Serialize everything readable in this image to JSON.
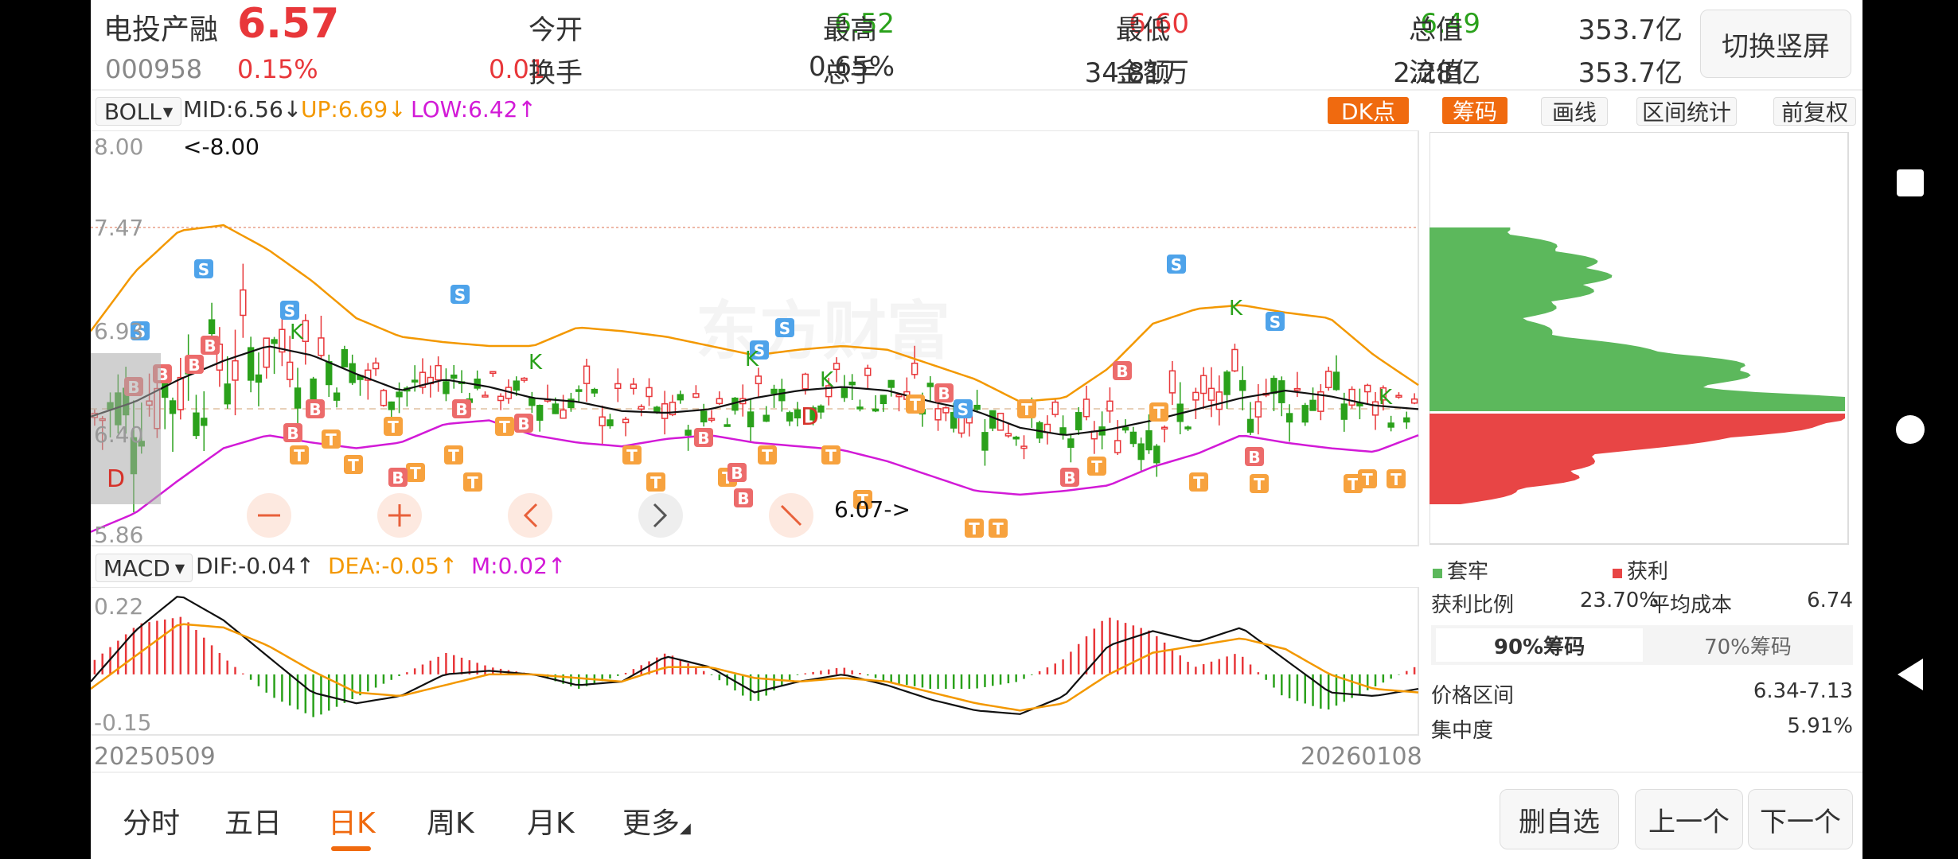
{
  "stock": {
    "name": "电投产融",
    "price": "6.57",
    "code": "000958",
    "change_pct": "0.15%",
    "change_amt": "0.01"
  },
  "quote": {
    "open_label": "今开",
    "open": "6.52",
    "high_label": "最高",
    "high": "6.60",
    "low_label": "最低",
    "low": "6.49",
    "total_cap_label": "总值",
    "total_cap": "353.7亿",
    "turnover_label": "换手",
    "turnover": "0.65%",
    "volume_label": "总手",
    "volume": "34.81万",
    "amount_label": "金额",
    "amount": "2.28亿",
    "float_cap_label": "流值",
    "float_cap": "353.7亿"
  },
  "switch_button": "切换竖屏",
  "boll": {
    "selector": "BOLL",
    "mid": "MID:6.56",
    "up": "UP:6.69",
    "low": "LOW:6.42"
  },
  "dk_button": "DK点",
  "right_tabs": {
    "chips": "筹码",
    "draw": "画线",
    "range_stats": "区间统计",
    "adjust": "前复权"
  },
  "price_axis": {
    "top": "8.00",
    "mid1": "7.47",
    "mid2": "6.93",
    "mid3": "6.40",
    "bottom": "5.86"
  },
  "annotations": {
    "high_marker": "<-8.00",
    "low_marker": "6.07->",
    "d_bottom_left": "D",
    "d_mid": "D"
  },
  "macd": {
    "selector": "MACD",
    "dif": "DIF:-0.04",
    "dea": "DEA:-0.05",
    "m": "M:0.02",
    "axis_top": "0.22",
    "axis_bottom": "-0.15"
  },
  "dates": {
    "start": "20250509",
    "end": "20260108"
  },
  "chips_panel": {
    "legend_trapped": "套牢",
    "legend_profit": "获利",
    "profit_ratio_label": "获利比例",
    "profit_ratio": "23.70%",
    "avg_cost_label": "平均成本",
    "avg_cost": "6.74",
    "tab90": "90%筹码",
    "tab70": "70%筹码",
    "price_range_label": "价格区间",
    "price_range": "6.34-7.13",
    "concentration_label": "集中度",
    "concentration": "5.91%"
  },
  "period_tabs": [
    "分时",
    "五日",
    "日K",
    "周K",
    "月K",
    "更多"
  ],
  "bottom_buttons": {
    "remove": "删自选",
    "prev": "上一个",
    "next": "下一个"
  },
  "colors": {
    "up": "#e8373a",
    "down": "#2aa11b",
    "mid": "#000000",
    "upper": "#f39800",
    "lower": "#d21ad7",
    "profit": "#e84545",
    "trapped": "#5cb85c"
  },
  "chart_data": {
    "type": "candlestick",
    "x_range": [
      "20250509",
      "20260108"
    ],
    "y_range": [
      5.86,
      8.0
    ],
    "series": [
      {
        "name": "MID",
        "values": [
          6.52,
          6.6,
          6.72,
          6.82,
          6.9,
          6.85,
          6.75,
          6.66,
          6.72,
          6.68,
          6.62,
          6.6,
          6.55,
          6.54,
          6.56,
          6.62,
          6.66,
          6.68,
          6.66,
          6.6,
          6.55,
          6.46,
          6.42,
          6.45,
          6.5,
          6.56,
          6.62,
          6.66,
          6.63,
          6.58,
          6.56
        ]
      },
      {
        "name": "UP",
        "values": [
          6.98,
          7.3,
          7.52,
          7.55,
          7.42,
          7.25,
          7.05,
          6.95,
          6.92,
          6.9,
          6.9,
          7.0,
          6.98,
          6.95,
          6.9,
          6.85,
          6.88,
          6.9,
          6.88,
          6.8,
          6.72,
          6.6,
          6.62,
          6.78,
          7.02,
          7.1,
          7.12,
          7.08,
          7.05,
          6.85,
          6.69
        ]
      },
      {
        "name": "LOW",
        "values": [
          5.9,
          6.0,
          6.18,
          6.35,
          6.42,
          6.38,
          6.35,
          6.38,
          6.48,
          6.5,
          6.42,
          6.38,
          6.36,
          6.4,
          6.42,
          6.38,
          6.36,
          6.34,
          6.28,
          6.2,
          6.12,
          6.1,
          6.12,
          6.15,
          6.25,
          6.32,
          6.42,
          6.38,
          6.35,
          6.33,
          6.42
        ]
      },
      {
        "name": "DIF",
        "values": [
          -0.02,
          0.12,
          0.22,
          0.15,
          0.05,
          -0.05,
          -0.08,
          -0.06,
          0.0,
          0.01,
          0.0,
          -0.03,
          -0.02,
          0.05,
          0.02,
          -0.05,
          -0.02,
          0.0,
          -0.03,
          -0.07,
          -0.1,
          -0.11,
          -0.06,
          0.08,
          0.12,
          0.09,
          0.13,
          0.04,
          -0.05,
          -0.06,
          -0.04
        ]
      },
      {
        "name": "DEA",
        "values": [
          -0.04,
          0.05,
          0.14,
          0.13,
          0.08,
          0.01,
          -0.05,
          -0.06,
          -0.03,
          0.0,
          0.0,
          -0.01,
          -0.02,
          0.02,
          0.02,
          -0.01,
          -0.02,
          -0.01,
          -0.02,
          -0.05,
          -0.08,
          -0.1,
          -0.08,
          0.0,
          0.06,
          0.08,
          0.1,
          0.07,
          0.0,
          -0.04,
          -0.05
        ]
      }
    ]
  }
}
